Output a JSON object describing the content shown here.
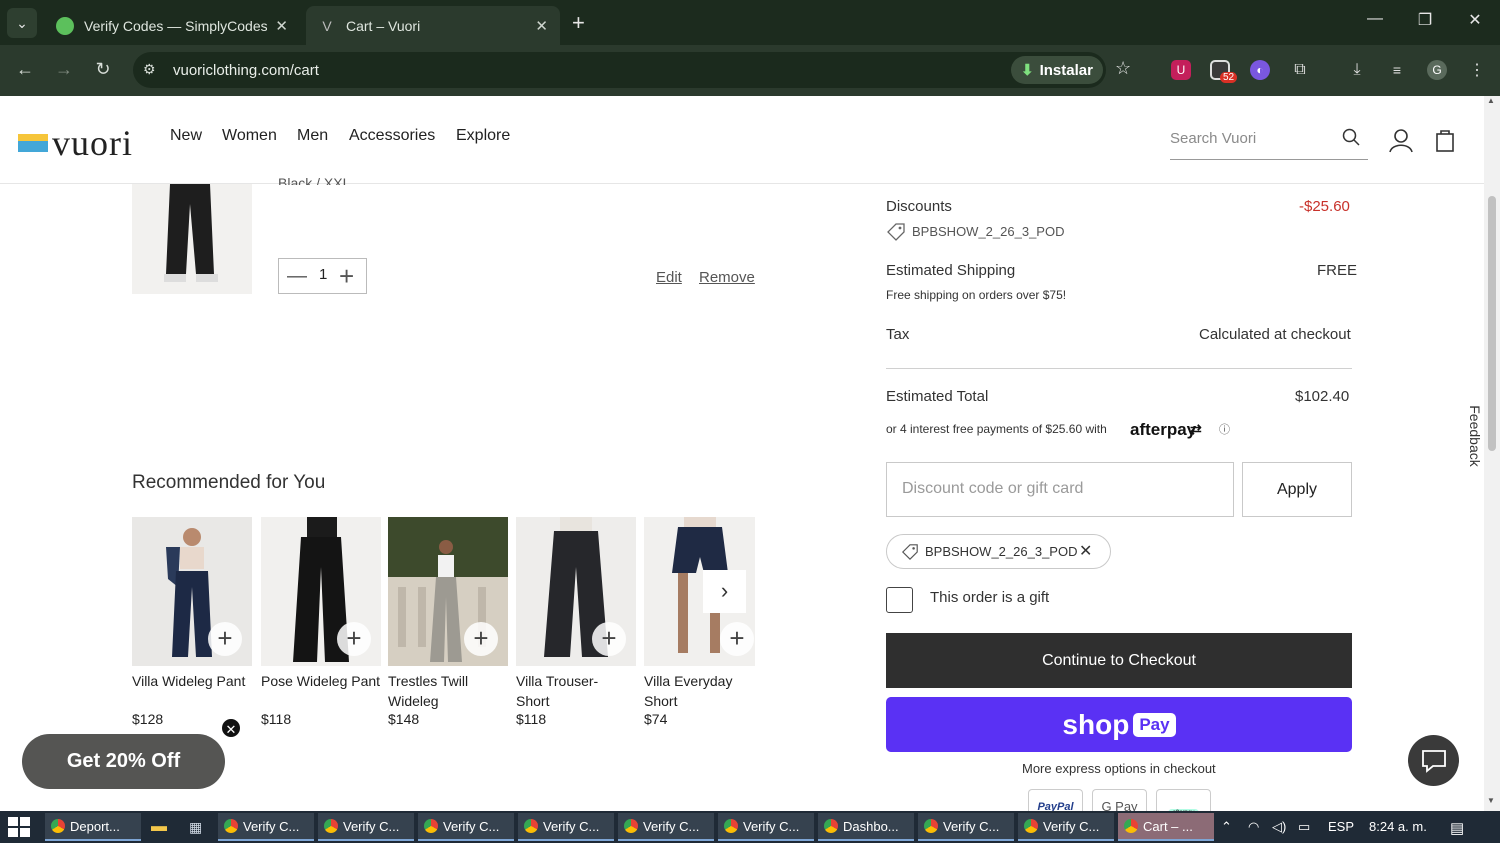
{
  "browser": {
    "tabs": [
      {
        "title": "Verify Codes — SimplyCodes"
      },
      {
        "title": "Cart – Vuori"
      }
    ],
    "url": "vuoriclothing.com/cart",
    "install_label": "Instalar",
    "extension_badge": "52",
    "profile_initial": "G"
  },
  "site": {
    "logo_text": "vuori",
    "nav": [
      "New",
      "Women",
      "Men",
      "Accessories",
      "Explore"
    ],
    "search_placeholder": "Search Vuori"
  },
  "cart_item": {
    "variant_partial": "Black / XXL",
    "quantity": "1",
    "edit_label": "Edit",
    "remove_label": "Remove"
  },
  "recommended": {
    "heading": "Recommended for You",
    "products": [
      {
        "name": "Villa Wideleg Pant",
        "price": "$128"
      },
      {
        "name": "Pose Wideleg Pant",
        "price": "$118"
      },
      {
        "name": "Trestles Twill Wideleg",
        "price": "$148"
      },
      {
        "name": "Villa Trouser-Short",
        "price": "$118"
      },
      {
        "name": "Villa Everyday Short",
        "price": "$74"
      }
    ]
  },
  "promo_popup": {
    "label": "Get 20% Off"
  },
  "summary": {
    "discounts_label": "Discounts",
    "discounts_value": "-$25.60",
    "discount_code": "BPBSHOW_2_26_3_POD",
    "shipping_label": "Estimated Shipping",
    "shipping_value": "FREE",
    "shipping_note": "Free shipping on orders over $75!",
    "tax_label": "Tax",
    "tax_value": "Calculated at checkout",
    "total_label": "Estimated Total",
    "total_value": "$102.40",
    "afterpay_text": "or 4 interest free payments of $25.60 with",
    "afterpay_brand": "afterpay",
    "discount_placeholder": "Discount code or gift card",
    "apply_label": "Apply",
    "applied_code": "BPBSHOW_2_26_3_POD",
    "gift_label": "This order is a gift",
    "checkout_label": "Continue to Checkout",
    "shoppay_label": "shop",
    "shoppay_pay": "Pay",
    "express_label": "More express options in checkout",
    "express_methods": [
      "PayPal",
      "G Pay",
      "afterpay"
    ]
  },
  "feedback_label": "Feedback",
  "colors": {
    "shoppay": "#5a31f4",
    "checkout": "#2f2f2f",
    "discount_red": "#c8312a"
  },
  "taskbar": {
    "items": [
      "Deport...",
      "",
      "",
      "Verify C...",
      "Verify C...",
      "Verify C...",
      "Verify C...",
      "Verify C...",
      "Verify C...",
      "Dashbo...",
      "Verify C...",
      "Verify C...",
      "Cart – ..."
    ],
    "language": "ESP",
    "time": "8:24 a. m."
  }
}
